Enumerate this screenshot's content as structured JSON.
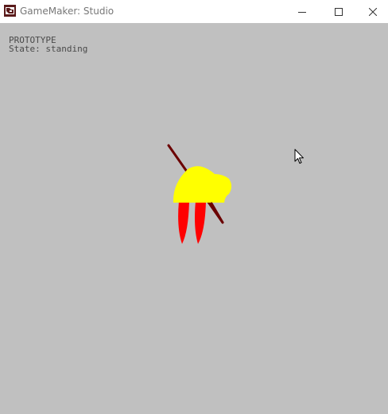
{
  "window": {
    "title": "GameMaker: Studio",
    "icon": "gamemaker-logo-icon",
    "controls": {
      "minimize_icon": "minimize-icon",
      "maximize_icon": "maximize-icon",
      "close_icon": "close-icon"
    }
  },
  "game": {
    "background_color": "#c0c0c0",
    "debug": {
      "line1": "PROTOTYPE",
      "line2": "State: standing"
    },
    "player": {
      "state": "standing",
      "body_color": "#ffff00",
      "legs_color": "#ff0000",
      "pole_color": "#6b0000"
    }
  },
  "cursor": {
    "icon": "arrow-cursor-icon"
  }
}
